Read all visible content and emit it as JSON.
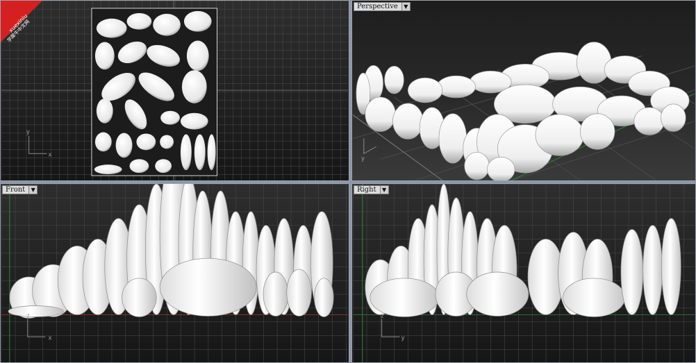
{
  "watermark": {
    "text_latin": "xuexiniu",
    "text_cn": "学犀牛中文网",
    "color": "#d42020"
  },
  "viewports": {
    "top": {
      "axis_x": "x",
      "axis_y": "y"
    },
    "perspective": {
      "label": "Perspective",
      "axis_y": "y"
    },
    "front": {
      "label": "Front",
      "axis_x": "x",
      "axis_z": "z"
    },
    "right": {
      "label": "Right",
      "axis_y": "y",
      "axis_z": "z"
    }
  },
  "colors": {
    "viewport_border": "#9aa3b5",
    "grid_line": "#555555",
    "x_axis": "#8a3030",
    "y_axis": "#2f8a3a",
    "model": "#f4f4f4",
    "model_shadow": "#b8b8b8"
  },
  "icons": {
    "dropdown": "triangle-down"
  }
}
